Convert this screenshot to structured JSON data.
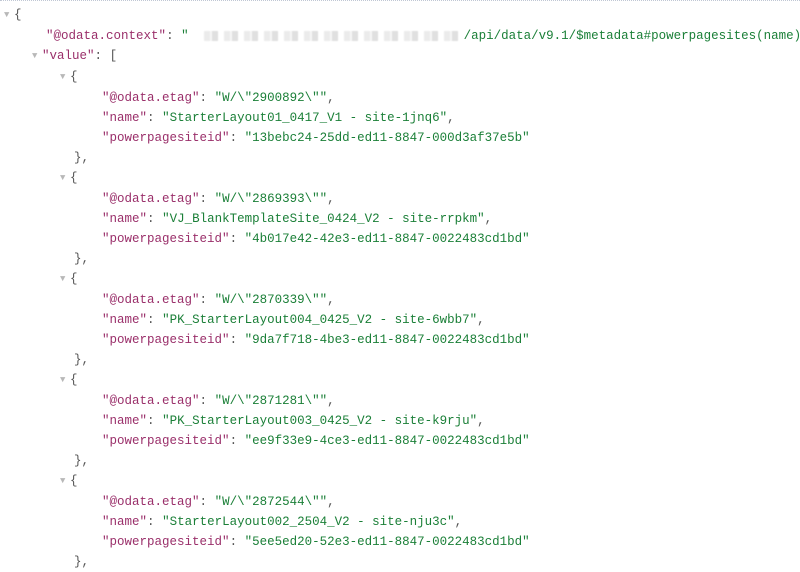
{
  "context_key": "@odata.context",
  "context_visible_suffix": "/api/data/v9.1/$metadata#powerpagesites(name)",
  "value_key": "value",
  "items": [
    {
      "etag_key": "@odata.etag",
      "etag": "W/\\\"2900892\\\"",
      "name_key": "name",
      "name": "StarterLayout01_0417_V1 - site-1jnq6",
      "id_key": "powerpagesiteid",
      "id": "13bebc24-25dd-ed11-8847-000d3af37e5b"
    },
    {
      "etag_key": "@odata.etag",
      "etag": "W/\\\"2869393\\\"",
      "name_key": "name",
      "name": "VJ_BlankTemplateSite_0424_V2 - site-rrpkm",
      "id_key": "powerpagesiteid",
      "id": "4b017e42-42e3-ed11-8847-0022483cd1bd"
    },
    {
      "etag_key": "@odata.etag",
      "etag": "W/\\\"2870339\\\"",
      "name_key": "name",
      "name": "PK_StarterLayout004_0425_V2 - site-6wbb7",
      "id_key": "powerpagesiteid",
      "id": "9da7f718-4be3-ed11-8847-0022483cd1bd"
    },
    {
      "etag_key": "@odata.etag",
      "etag": "W/\\\"2871281\\\"",
      "name_key": "name",
      "name": "PK_StarterLayout003_0425_V2 - site-k9rju",
      "id_key": "powerpagesiteid",
      "id": "ee9f33e9-4ce3-ed11-8847-0022483cd1bd"
    },
    {
      "etag_key": "@odata.etag",
      "etag": "W/\\\"2872544\\\"",
      "name_key": "name",
      "name": "StarterLayout002_2504_V2 - site-nju3c",
      "id_key": "powerpagesiteid",
      "id": "5ee5ed20-52e3-ed11-8847-0022483cd1bd"
    }
  ]
}
